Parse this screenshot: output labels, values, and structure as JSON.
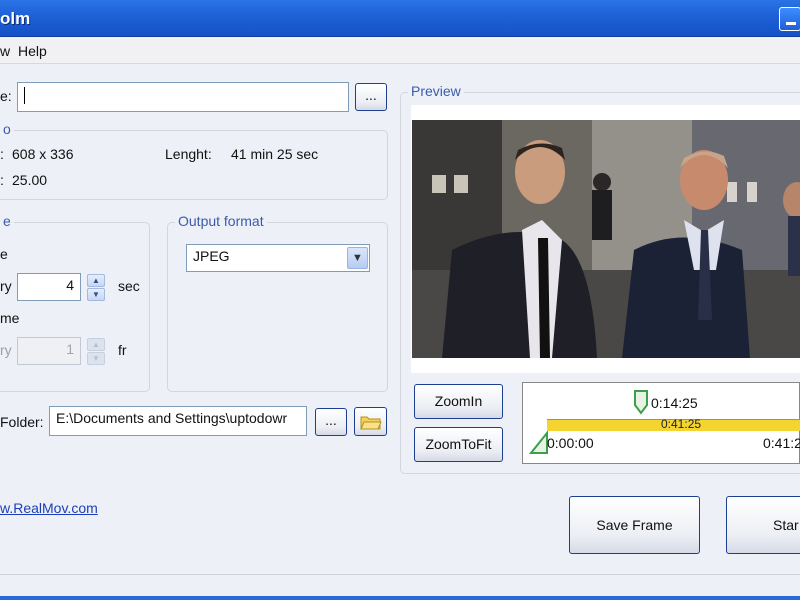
{
  "window": {
    "title": "olm",
    "minimize_label": "minimize"
  },
  "menu": [
    "w",
    "Help"
  ],
  "file": {
    "label": "e:",
    "value": "",
    "browse_label": "..."
  },
  "info": {
    "group_label": "o",
    "size_label": ":",
    "size_value": "608 x 336",
    "fps_label": ":",
    "fps_value": "25.00",
    "length_label": "Lenght:",
    "length_value": "41 min 25 sec"
  },
  "capture": {
    "group_label": "e",
    "option1_label": "e",
    "every_label": "ry",
    "every_value": "4",
    "every_unit": "sec",
    "option2_label": "me",
    "frame_label": "ry",
    "frame_value": "1",
    "frame_unit": "fr"
  },
  "output": {
    "group_label": "Output format",
    "format_value": "JPEG"
  },
  "folder": {
    "label": "Folder:",
    "value": "E:\\Documents and Settings\\uptodowr",
    "browse_label": "..."
  },
  "link": "w.RealMov.com",
  "preview": {
    "group_label": "Preview"
  },
  "zoom": {
    "zoom_in_label": "ZoomIn",
    "zoom_fit_label": "ZoomToFit"
  },
  "timeline": {
    "current_time": "0:14:25",
    "bar_time": "0:41:25",
    "start_time": "0:00:00",
    "end_time": "0:41:2"
  },
  "buttons": {
    "save_frame": "Save Frame",
    "start": "Star"
  },
  "colors": {
    "title_bar": "#1f62d8",
    "group_label": "#3b5ba9",
    "timeline_bar": "#f3d431",
    "link": "#1b3eb8"
  }
}
